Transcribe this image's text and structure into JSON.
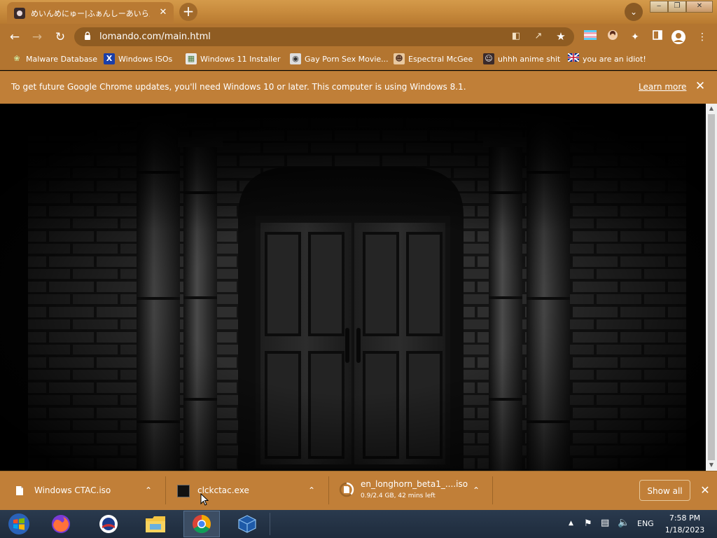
{
  "browser": {
    "tab_title": "めいんめにゅー|ふぁんしーあいらんど",
    "tab_close": "✕",
    "new_tab": "+",
    "tab_search": "⌄",
    "window_buttons": {
      "minimize": "‒",
      "restore": "❐",
      "close": "✕"
    },
    "url": "lomando.com/main.html"
  },
  "bookmarks": [
    {
      "label": "Malware Database",
      "icon": "leaf-icon"
    },
    {
      "label": "Windows ISOs",
      "icon": "x-logo-icon"
    },
    {
      "label": "Windows 11 Installer",
      "icon": "image-icon"
    },
    {
      "label": "Gay Porn Sex Movie...",
      "icon": "globe-icon"
    },
    {
      "label": "Espectral McGee",
      "icon": "avatar-icon"
    },
    {
      "label": "uhhh anime shit",
      "icon": "anime-icon"
    },
    {
      "label": "you are an idiot!",
      "icon": "flag-icon"
    }
  ],
  "infobar": {
    "message": "To get future Google Chrome updates, you'll need Windows 10 or later. This computer is using Windows 8.1.",
    "learn_more": "Learn more",
    "close": "✕"
  },
  "downloads": {
    "items": [
      {
        "name": "Windows CTAC.iso",
        "status": ""
      },
      {
        "name": "clckctac.exe",
        "status": ""
      },
      {
        "name": "en_longhorn_beta1_....iso",
        "status": "0.9/2.4 GB, 42 mins left",
        "progress": 0.375
      }
    ],
    "show_all": "Show all",
    "close": "✕"
  },
  "taskbar": {
    "apps": [
      "windows-start",
      "firefox",
      "opera-logo",
      "file-explorer",
      "chrome",
      "virtualbox"
    ],
    "tray": {
      "language": "ENG",
      "time": "7:58 PM",
      "date": "1/18/2023"
    }
  },
  "colors": {
    "chrome_theme": "#b37530",
    "infobar": "#c07f38",
    "taskbar": "#243246"
  }
}
